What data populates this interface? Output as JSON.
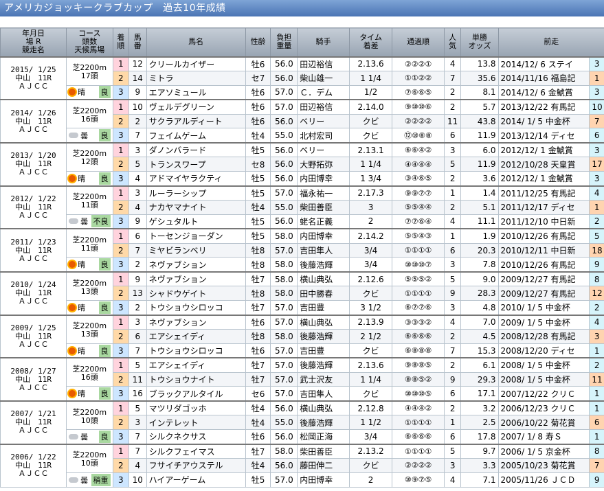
{
  "page_title": "アメリカジョッキークラブカップ　過去10年成績",
  "headers": {
    "date": [
      "年月日",
      "場 R",
      "競走名"
    ],
    "course": [
      "コース",
      "頭数",
      "天候馬場"
    ],
    "pos": [
      "着",
      "順"
    ],
    "num": [
      "馬",
      "番"
    ],
    "horse": "馬名",
    "sex": "性齢",
    "wt": [
      "負担",
      "重量"
    ],
    "jockey": "騎手",
    "time": [
      "タイム",
      "着差"
    ],
    "pass": "通過順",
    "pop": [
      "人",
      "気"
    ],
    "odds": [
      "単勝",
      "オッズ"
    ],
    "prev": "前走"
  },
  "races": [
    {
      "date": "2015/ 1/25",
      "venue": "中山　11R",
      "race": "ＡＪＣＣ",
      "course": "芝2200m",
      "runners": "17頭",
      "weather": "晴",
      "weather_icon": "sun-icon",
      "cond": "良",
      "rows": [
        {
          "pos": "1",
          "num": "12",
          "horse": "クリールカイザー",
          "sex": "牡6",
          "wt": "56.0",
          "jockey": "田辺裕信",
          "time": "2.13.6",
          "pass": "②②②①",
          "pop": "4",
          "odds": "13.8",
          "prev": "2014/12/ 6 ステイ",
          "prevpos": "3"
        },
        {
          "pos": "2",
          "num": "14",
          "horse": "ミトラ",
          "sex": "セ7",
          "wt": "56.0",
          "jockey": "柴山雄一",
          "time": "1 1/4",
          "pass": "①①②②",
          "pop": "7",
          "odds": "35.6",
          "prev": "2014/11/16 福島記",
          "prevpos": "1"
        },
        {
          "pos": "3",
          "num": "9",
          "horse": "エアソミュール",
          "sex": "牡6",
          "wt": "57.0",
          "jockey": "Ｃ．デム",
          "time": "1/2",
          "pass": "⑦⑥⑥⑤",
          "pop": "2",
          "odds": "8.1",
          "prev": "2014/12/ 6 金鯱賞",
          "prevpos": "3"
        }
      ]
    },
    {
      "date": "2014/ 1/26",
      "venue": "中山　11R",
      "race": "ＡＪＣＣ",
      "course": "芝2200m",
      "runners": "16頭",
      "weather": "曇",
      "weather_icon": "cloud-icon",
      "cond": "良",
      "rows": [
        {
          "pos": "1",
          "num": "10",
          "horse": "ヴェルデグリーン",
          "sex": "牡6",
          "wt": "57.0",
          "jockey": "田辺裕信",
          "time": "2.14.0",
          "pass": "⑨⑩⑩⑥",
          "pop": "2",
          "odds": "5.7",
          "prev": "2013/12/22 有馬記",
          "prevpos": "10"
        },
        {
          "pos": "2",
          "num": "2",
          "horse": "サクラアルディート",
          "sex": "牡6",
          "wt": "56.0",
          "jockey": "ベリー",
          "time": "クビ",
          "pass": "②②②②",
          "pop": "11",
          "odds": "43.8",
          "prev": "2014/ 1/ 5 中金杯",
          "prevpos": "7"
        },
        {
          "pos": "3",
          "num": "7",
          "horse": "フェイムゲーム",
          "sex": "牡4",
          "wt": "55.0",
          "jockey": "北村宏司",
          "time": "クビ",
          "pass": "⑫⑩⑧⑧",
          "pop": "6",
          "odds": "11.9",
          "prev": "2013/12/14 ディセ",
          "prevpos": "6"
        }
      ]
    },
    {
      "date": "2013/ 1/20",
      "venue": "中山　11R",
      "race": "ＡＪＣＣ",
      "course": "芝2200m",
      "runners": "12頭",
      "weather": "晴",
      "weather_icon": "sun-icon",
      "cond": "良",
      "rows": [
        {
          "pos": "1",
          "num": "3",
          "horse": "ダノンバラード",
          "sex": "牡5",
          "wt": "56.0",
          "jockey": "ベリー",
          "time": "2.13.1",
          "pass": "⑥⑥④②",
          "pop": "3",
          "odds": "6.0",
          "prev": "2012/12/ 1 金鯱賞",
          "prevpos": "3"
        },
        {
          "pos": "2",
          "num": "5",
          "horse": "トランスワープ",
          "sex": "セ8",
          "wt": "56.0",
          "jockey": "大野拓弥",
          "time": "1 1/4",
          "pass": "④④④④",
          "pop": "5",
          "odds": "11.9",
          "prev": "2012/10/28 天皇賞",
          "prevpos": "17"
        },
        {
          "pos": "3",
          "num": "4",
          "horse": "アドマイヤラクティ",
          "sex": "牡5",
          "wt": "56.0",
          "jockey": "内田博幸",
          "time": "1 3/4",
          "pass": "③④⑥⑤",
          "pop": "2",
          "odds": "3.6",
          "prev": "2012/12/ 1 金鯱賞",
          "prevpos": "3"
        }
      ]
    },
    {
      "date": "2012/ 1/22",
      "venue": "中山　11R",
      "race": "ＡＪＣＣ",
      "course": "芝2200m",
      "runners": "11頭",
      "weather": "曇",
      "weather_icon": "cloud-icon",
      "cond": "不良",
      "rows": [
        {
          "pos": "1",
          "num": "3",
          "horse": "ルーラーシップ",
          "sex": "牡5",
          "wt": "57.0",
          "jockey": "福永祐一",
          "time": "2.17.3",
          "pass": "⑨⑨⑦⑦",
          "pop": "1",
          "odds": "1.4",
          "prev": "2011/12/25 有馬記",
          "prevpos": "4"
        },
        {
          "pos": "2",
          "num": "4",
          "horse": "ナカヤマナイト",
          "sex": "牡4",
          "wt": "55.0",
          "jockey": "柴田善臣",
          "time": "3",
          "pass": "⑤⑤④④",
          "pop": "2",
          "odds": "5.1",
          "prev": "2011/12/17 ディセ",
          "prevpos": "1"
        },
        {
          "pos": "3",
          "num": "9",
          "horse": "ゲシュタルト",
          "sex": "牡5",
          "wt": "56.0",
          "jockey": "蛯名正義",
          "time": "2",
          "pass": "⑦⑦⑥④",
          "pop": "4",
          "odds": "11.1",
          "prev": "2011/12/10 中日新",
          "prevpos": "2"
        }
      ]
    },
    {
      "date": "2011/ 1/23",
      "venue": "中山　11R",
      "race": "ＡＪＣＣ",
      "course": "芝2200m",
      "runners": "11頭",
      "weather": "晴",
      "weather_icon": "sun-icon",
      "cond": "良",
      "rows": [
        {
          "pos": "1",
          "num": "6",
          "horse": "トーセンジョーダン",
          "sex": "牡5",
          "wt": "58.0",
          "jockey": "内田博幸",
          "time": "2.14.2",
          "pass": "⑤⑤④③",
          "pop": "1",
          "odds": "1.9",
          "prev": "2010/12/26 有馬記",
          "prevpos": "5"
        },
        {
          "pos": "2",
          "num": "7",
          "horse": "ミヤビランベリ",
          "sex": "牡8",
          "wt": "57.0",
          "jockey": "吉田隼人",
          "time": "3/4",
          "pass": "①①①①",
          "pop": "6",
          "odds": "20.3",
          "prev": "2010/12/11 中日新",
          "prevpos": "18"
        },
        {
          "pos": "3",
          "num": "2",
          "horse": "ネヴァブション",
          "sex": "牡8",
          "wt": "58.0",
          "jockey": "後藤浩輝",
          "time": "3/4",
          "pass": "⑩⑩⑩⑦",
          "pop": "3",
          "odds": "7.8",
          "prev": "2010/12/26 有馬記",
          "prevpos": "9"
        }
      ]
    },
    {
      "date": "2010/ 1/24",
      "venue": "中山　11R",
      "race": "ＡＪＣＣ",
      "course": "芝2200m",
      "runners": "13頭",
      "weather": "晴",
      "weather_icon": "sun-icon",
      "cond": "良",
      "rows": [
        {
          "pos": "1",
          "num": "9",
          "horse": "ネヴァブション",
          "sex": "牡7",
          "wt": "58.0",
          "jockey": "横山典弘",
          "time": "2.12.6",
          "pass": "⑤⑤⑤②",
          "pop": "5",
          "odds": "9.0",
          "prev": "2009/12/27 有馬記",
          "prevpos": "8"
        },
        {
          "pos": "2",
          "num": "13",
          "horse": "シャドウゲイト",
          "sex": "牡8",
          "wt": "58.0",
          "jockey": "田中勝春",
          "time": "クビ",
          "pass": "①①①①",
          "pop": "9",
          "odds": "28.3",
          "prev": "2009/12/27 有馬記",
          "prevpos": "12"
        },
        {
          "pos": "3",
          "num": "2",
          "horse": "トウショウシロッコ",
          "sex": "牡7",
          "wt": "57.0",
          "jockey": "吉田豊",
          "time": "3 1/2",
          "pass": "⑥⑦⑦⑥",
          "pop": "3",
          "odds": "4.8",
          "prev": "2010/ 1/ 5 中金杯",
          "prevpos": "2"
        }
      ]
    },
    {
      "date": "2009/ 1/25",
      "venue": "中山　11R",
      "race": "ＡＪＣＣ",
      "course": "芝2200m",
      "runners": "13頭",
      "weather": "晴",
      "weather_icon": "sun-icon",
      "cond": "良",
      "rows": [
        {
          "pos": "1",
          "num": "3",
          "horse": "ネヴァブション",
          "sex": "牡6",
          "wt": "57.0",
          "jockey": "横山典弘",
          "time": "2.13.9",
          "pass": "③③③②",
          "pop": "4",
          "odds": "7.0",
          "prev": "2009/ 1/ 5 中金杯",
          "prevpos": "4"
        },
        {
          "pos": "2",
          "num": "6",
          "horse": "エアシェイディ",
          "sex": "牡8",
          "wt": "58.0",
          "jockey": "後藤浩輝",
          "time": "2 1/2",
          "pass": "⑥⑥⑥⑥",
          "pop": "2",
          "odds": "4.5",
          "prev": "2008/12/28 有馬記",
          "prevpos": "3"
        },
        {
          "pos": "3",
          "num": "7",
          "horse": "トウショウシロッコ",
          "sex": "牡6",
          "wt": "57.0",
          "jockey": "吉田豊",
          "time": "クビ",
          "pass": "⑥⑧⑧⑧",
          "pop": "7",
          "odds": "15.3",
          "prev": "2008/12/20 ディセ",
          "prevpos": "1"
        }
      ]
    },
    {
      "date": "2008/ 1/27",
      "venue": "中山　11R",
      "race": "ＡＪＣＣ",
      "course": "芝2200m",
      "runners": "16頭",
      "weather": "晴",
      "weather_icon": "sun-icon",
      "cond": "良",
      "rows": [
        {
          "pos": "1",
          "num": "5",
          "horse": "エアシェイディ",
          "sex": "牡7",
          "wt": "57.0",
          "jockey": "後藤浩輝",
          "time": "2.13.6",
          "pass": "⑨⑧⑧⑤",
          "pop": "2",
          "odds": "6.1",
          "prev": "2008/ 1/ 5 中金杯",
          "prevpos": "2"
        },
        {
          "pos": "2",
          "num": "11",
          "horse": "トウショウナイト",
          "sex": "牡7",
          "wt": "57.0",
          "jockey": "武士沢友",
          "time": "1 1/4",
          "pass": "⑧⑧⑤②",
          "pop": "9",
          "odds": "29.3",
          "prev": "2008/ 1/ 5 中金杯",
          "prevpos": "11"
        },
        {
          "pos": "3",
          "num": "16",
          "horse": "ブラックアルタイル",
          "sex": "セ6",
          "wt": "57.0",
          "jockey": "吉田隼人",
          "time": "クビ",
          "pass": "⑩⑩⑩⑤",
          "pop": "6",
          "odds": "17.1",
          "prev": "2007/12/22 クリＣ",
          "prevpos": "1"
        }
      ]
    },
    {
      "date": "2007/ 1/21",
      "venue": "中山　11R",
      "race": "ＡＪＣＣ",
      "course": "芝2200m",
      "runners": "10頭",
      "weather": "曇",
      "weather_icon": "cloud-icon",
      "cond": "良",
      "rows": [
        {
          "pos": "1",
          "num": "5",
          "horse": "マツリダゴッホ",
          "sex": "牡4",
          "wt": "56.0",
          "jockey": "横山典弘",
          "time": "2.12.8",
          "pass": "④④④②",
          "pop": "2",
          "odds": "3.2",
          "prev": "2006/12/23 クリＣ",
          "prevpos": "1"
        },
        {
          "pos": "2",
          "num": "3",
          "horse": "インテレット",
          "sex": "牡4",
          "wt": "55.0",
          "jockey": "後藤浩輝",
          "time": "1 1/2",
          "pass": "①①①①",
          "pop": "1",
          "odds": "2.5",
          "prev": "2006/10/22 菊花賞",
          "prevpos": "6"
        },
        {
          "pos": "3",
          "num": "7",
          "horse": "シルクネクサス",
          "sex": "牡6",
          "wt": "56.0",
          "jockey": "松岡正海",
          "time": "3/4",
          "pass": "⑥⑥⑥⑥",
          "pop": "6",
          "odds": "17.8",
          "prev": "2007/ 1/ 8 寿Ｓ",
          "prevpos": "1"
        }
      ]
    },
    {
      "date": "2006/ 1/22",
      "venue": "中山　11R",
      "race": "ＡＪＣＣ",
      "course": "芝2200m",
      "runners": "10頭",
      "weather": "曇",
      "weather_icon": "cloud-icon",
      "cond": "稍重",
      "rows": [
        {
          "pos": "1",
          "num": "7",
          "horse": "シルクフェイマス",
          "sex": "牡7",
          "wt": "58.0",
          "jockey": "柴田善臣",
          "time": "2.13.2",
          "pass": "①①①①",
          "pop": "5",
          "odds": "9.7",
          "prev": "2006/ 1/ 5 京金杯",
          "prevpos": "8"
        },
        {
          "pos": "2",
          "num": "4",
          "horse": "フサイチアウステル",
          "sex": "牡4",
          "wt": "56.0",
          "jockey": "藤田伸二",
          "time": "クビ",
          "pass": "②②②②",
          "pop": "3",
          "odds": "3.3",
          "prev": "2005/10/23 菊花賞",
          "prevpos": "7"
        },
        {
          "pos": "3",
          "num": "10",
          "horse": "ハイアーゲーム",
          "sex": "牡5",
          "wt": "57.0",
          "jockey": "内田博幸",
          "time": "2",
          "pass": "⑩⑨⑦⑤",
          "pop": "4",
          "odds": "7.1",
          "prev": "2005/11/26 ＪＣＤ",
          "prevpos": "9"
        }
      ]
    }
  ]
}
